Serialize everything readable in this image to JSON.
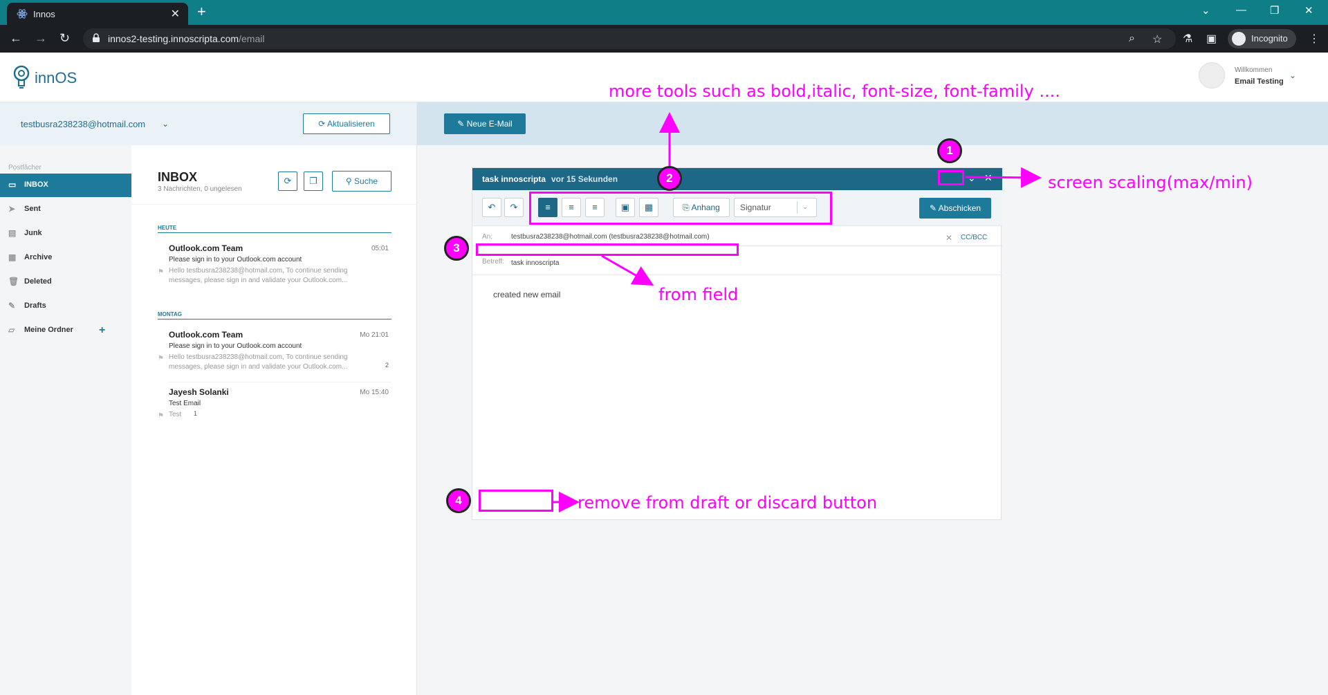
{
  "browser": {
    "tab_title": "Innos",
    "url_host": "innos2-testing.innoscripta.com",
    "url_path": "/email",
    "incognito_label": "Incognito"
  },
  "app": {
    "logo_text": "innOS",
    "welcome": "Willkommen",
    "username": "Email Testing"
  },
  "account": {
    "email": "testbusra238238@hotmail.com",
    "refresh_label": "Aktualisieren",
    "new_email_label": "Neue E-Mail"
  },
  "sidebar": {
    "heading": "Postfächer",
    "items": [
      {
        "label": "INBOX",
        "icon": "inbox-icon"
      },
      {
        "label": "Sent",
        "icon": "send-icon"
      },
      {
        "label": "Junk",
        "icon": "junk-icon"
      },
      {
        "label": "Archive",
        "icon": "archive-icon"
      },
      {
        "label": "Deleted",
        "icon": "trash-icon"
      },
      {
        "label": "Drafts",
        "icon": "pencil-icon"
      },
      {
        "label": "Meine Ordner",
        "icon": "folder-icon"
      }
    ]
  },
  "list": {
    "title": "INBOX",
    "subtitle": "3 Nachrichten, 0 ungelesen",
    "search_label": "Suche",
    "groups": [
      {
        "label": "HEUTE",
        "messages": [
          {
            "sender": "Outlook.com Team",
            "time": "05:01",
            "subject": "Please sign in to your Outlook.com account",
            "preview": "Hello testbusra238238@hotmail.com, To continue sending messages, please sign in and validate your Outlook.com..."
          }
        ]
      },
      {
        "label": "MONTAG",
        "messages": [
          {
            "sender": "Outlook.com Team",
            "time": "Mo 21:01",
            "subject": "Please sign in to your Outlook.com account",
            "preview": "Hello testbusra238238@hotmail.com, To continue sending messages, please sign in and validate your Outlook.com...",
            "count": "2"
          },
          {
            "sender": "Jayesh Solanki",
            "time": "Mo 15:40",
            "subject": "Test Email",
            "preview": "Test",
            "count": "1"
          }
        ]
      }
    ]
  },
  "compose": {
    "title": "task innoscripta",
    "saved": "vor 15 Sekunden",
    "attach_label": "Anhang",
    "signature_label": "Signatur",
    "send_label": "Abschicken",
    "to_label": "An:",
    "to_value": "testbusra238238@hotmail.com (testbusra238238@hotmail.com)",
    "ccbcc_label": "CC/BCC",
    "subject_label": "Betreff:",
    "subject_value": "task innoscripta",
    "body": "created new email"
  },
  "annotations": {
    "n1": "1",
    "n2": "2",
    "n3": "3",
    "n4": "4",
    "more_tools": "more tools such as bold,italic, font-size, font-family ....",
    "screen_scaling": "screen scaling(max/min)",
    "from_field": "from field",
    "discard": "remove from draft or discard button",
    "color": "#ff00ff"
  }
}
